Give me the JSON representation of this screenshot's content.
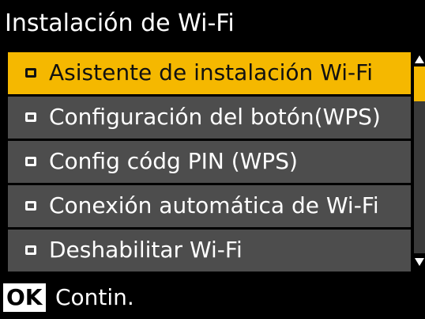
{
  "title": "Instalación de Wi-Fi",
  "menu": {
    "items": [
      {
        "label": "Asistente de instalación Wi-Fi",
        "selected": true
      },
      {
        "label": "Configuración del botón(WPS)",
        "selected": false
      },
      {
        "label": "Config códg PIN (WPS)",
        "selected": false
      },
      {
        "label": "Conexión automática de Wi-Fi",
        "selected": false
      },
      {
        "label": "Deshabilitar Wi-Fi",
        "selected": false
      }
    ]
  },
  "footer": {
    "ok_label": "OK",
    "action_label": "Contin."
  },
  "colors": {
    "accent": "#f5b800",
    "item_bg": "#4d4d4d",
    "background": "#000000"
  }
}
